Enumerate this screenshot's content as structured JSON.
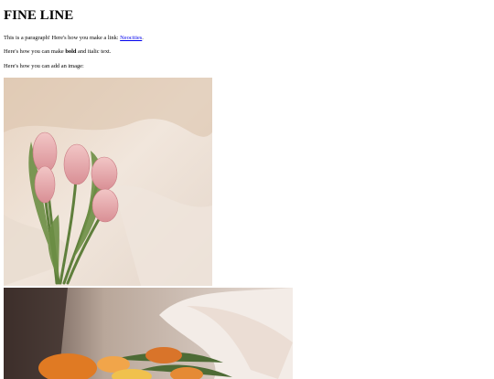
{
  "page": {
    "title": "FINE LINE",
    "para1": {
      "text_before": "This is a paragraph! Here's how you make a link: ",
      "link_label": "Neocities",
      "text_after": "."
    },
    "para2": {
      "text_before": "Here's how you can make ",
      "bold_text": "bold",
      "text_after": " and italic text."
    },
    "para3": {
      "text": "Here's how you can add an image:"
    }
  },
  "images": [
    {
      "icon": "tulips-bouquet-photo"
    },
    {
      "icon": "orange-flowers-photo"
    }
  ]
}
